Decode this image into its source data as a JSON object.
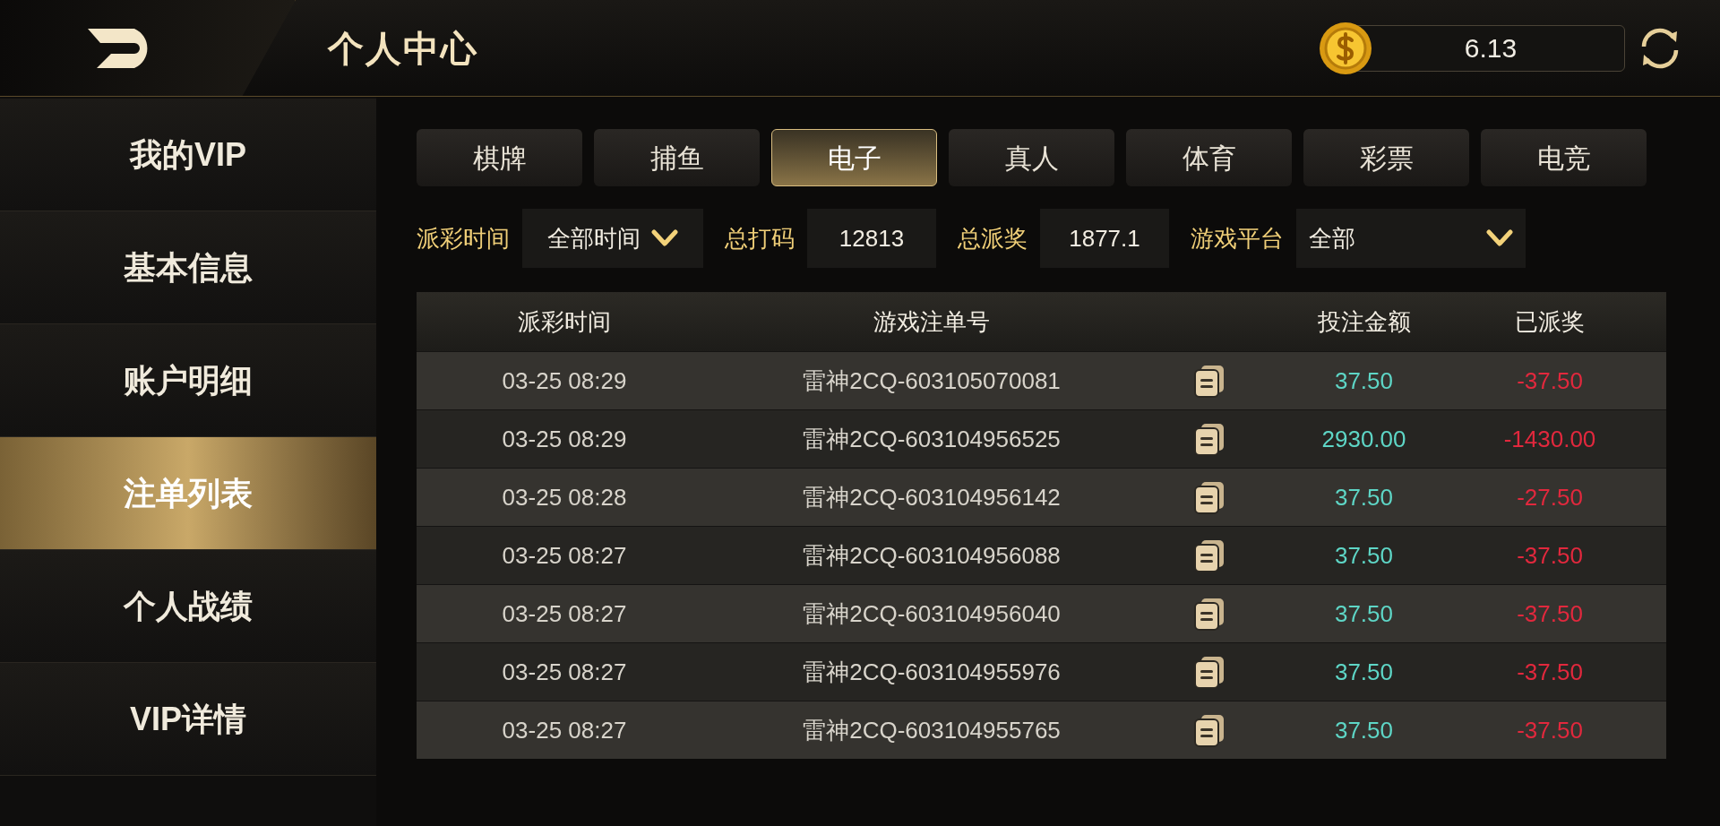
{
  "header": {
    "title": "个人中心",
    "balance": "6.13"
  },
  "sidebar": {
    "items": [
      {
        "label": "我的VIP",
        "selected": false
      },
      {
        "label": "基本信息",
        "selected": false
      },
      {
        "label": "账户明细",
        "selected": false
      },
      {
        "label": "注单列表",
        "selected": true
      },
      {
        "label": "个人战绩",
        "selected": false
      },
      {
        "label": "VIP详情",
        "selected": false
      }
    ]
  },
  "tabs": [
    {
      "label": "棋牌",
      "selected": false
    },
    {
      "label": "捕鱼",
      "selected": false
    },
    {
      "label": "电子",
      "selected": true
    },
    {
      "label": "真人",
      "selected": false
    },
    {
      "label": "体育",
      "selected": false
    },
    {
      "label": "彩票",
      "selected": false
    },
    {
      "label": "电竞",
      "selected": false
    }
  ],
  "filters": {
    "time_label": "派彩时间",
    "time_value": "全部时间",
    "total_bet_label": "总打码",
    "total_bet": "12813",
    "total_payout_label": "总派奖",
    "total_payout": "1877.1",
    "platform_label": "游戏平台",
    "platform_value": "全部"
  },
  "table": {
    "columns": [
      "派彩时间",
      "游戏注单号",
      "投注金额",
      "已派奖"
    ],
    "rows": [
      {
        "time": "03-25 08:29",
        "order": "雷神2CQ-603105070081",
        "bet": "37.50",
        "payout": "-37.50"
      },
      {
        "time": "03-25 08:29",
        "order": "雷神2CQ-603104956525",
        "bet": "2930.00",
        "payout": "-1430.00"
      },
      {
        "time": "03-25 08:28",
        "order": "雷神2CQ-603104956142",
        "bet": "37.50",
        "payout": "-27.50"
      },
      {
        "time": "03-25 08:27",
        "order": "雷神2CQ-603104956088",
        "bet": "37.50",
        "payout": "-37.50"
      },
      {
        "time": "03-25 08:27",
        "order": "雷神2CQ-603104956040",
        "bet": "37.50",
        "payout": "-37.50"
      },
      {
        "time": "03-25 08:27",
        "order": "雷神2CQ-603104955976",
        "bet": "37.50",
        "payout": "-37.50"
      },
      {
        "time": "03-25 08:27",
        "order": "雷神2CQ-603104955765",
        "bet": "37.50",
        "payout": "-37.50"
      }
    ]
  }
}
